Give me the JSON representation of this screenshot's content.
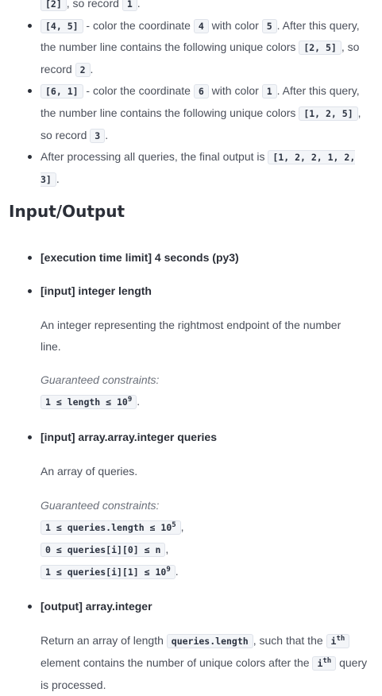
{
  "example": {
    "partial_top": {
      "code": "[2]",
      "text": ", so record ",
      "record": "1",
      "end": "."
    },
    "bullets": [
      {
        "query": "[4, 5]",
        "t1": " - color the coordinate ",
        "coord": "4",
        "t2": " with color ",
        "color": "5",
        "t3": ". After this query, the number line contains the following unique colors ",
        "colors": "[2, 5]",
        "t4": ", so record ",
        "record": "2",
        "t5": "."
      },
      {
        "query": "[6, 1]",
        "t1": " - color the coordinate ",
        "coord": "6",
        "t2": " with color ",
        "color": "1",
        "t3": ". After this query, the number line contains the following unique colors ",
        "colors": "[1, 2, 5]",
        "t4": ", so record ",
        "record": "3",
        "t5": "."
      }
    ],
    "final": {
      "text": "After processing all queries, the final output is ",
      "output": "[1, 2, 2, 1, 2, 3]",
      "end": "."
    }
  },
  "io": {
    "heading": "Input/Output",
    "time_limit": "[execution time limit] 4 seconds (py3)",
    "length": {
      "title": "[input] integer length",
      "desc": "An integer representing the rightmost endpoint of the number line.",
      "constraints_label": "Guaranteed constraints:",
      "c1_pre": "1 ≤ length ≤ 10",
      "c1_exp": "9",
      "c1_end": "."
    },
    "queries": {
      "title": "[input] array.array.integer queries",
      "desc": "An array of queries.",
      "constraints_label": "Guaranteed constraints:",
      "c1_pre": "1 ≤ queries.length ≤ 10",
      "c1_exp": "5",
      "c1_end": ",",
      "c2": "0 ≤ queries[i][0] ≤ n",
      "c2_end": ",",
      "c3_pre": "1 ≤ queries[i][1] ≤ 10",
      "c3_exp": "9",
      "c3_end": "."
    },
    "output": {
      "title": "[output] array.integer",
      "d1": "Return an array of length ",
      "len_code": "queries.length",
      "d2": ", such that the ",
      "ith1_i": "i",
      "ith1_sup": "th",
      "d3": " element contains the number of unique colors after the ",
      "ith2_i": "i",
      "ith2_sup": "th",
      "d4": " query is processed."
    }
  }
}
